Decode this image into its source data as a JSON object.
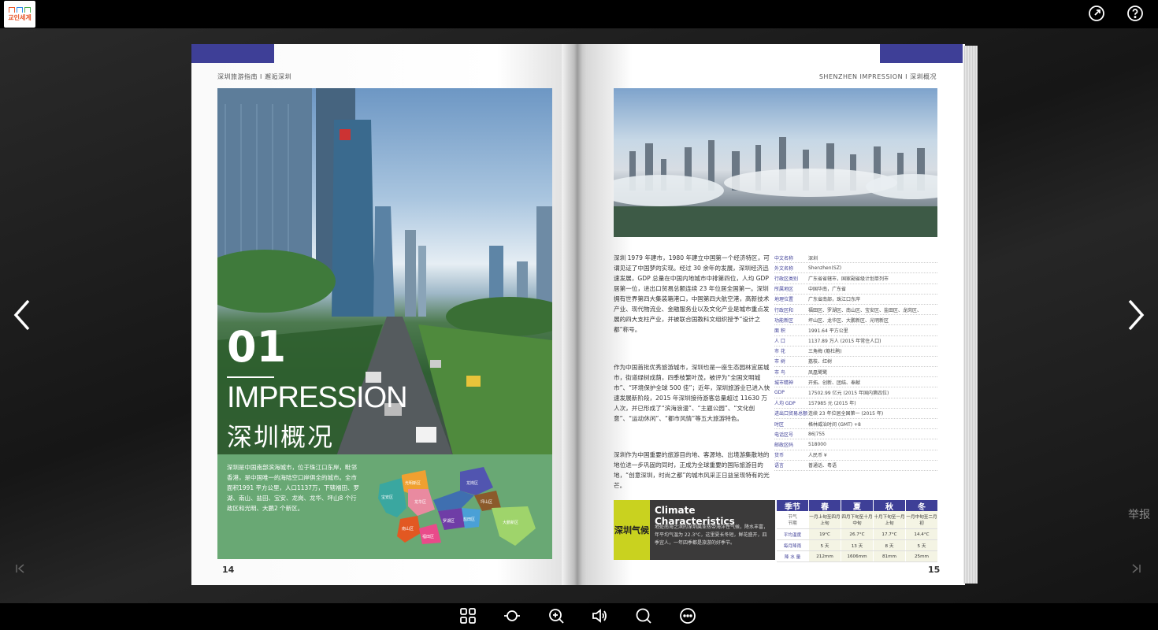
{
  "app": {
    "logo_text": "교인세계",
    "share_icon": "share-icon",
    "help_icon": "help-icon",
    "report_label": "举报"
  },
  "left_page": {
    "running_head": "深圳旅游指南 Ι 邂逅深圳",
    "number": "01",
    "title_en": "IMPRESSION",
    "title_cn": "深圳概况",
    "intro": "深圳是中国南部滨海城市，位于珠江口东岸，毗邻香港，是中国唯一的海陆空口岸俱全的城市。全市面积1991 平方公里，人口1137万，下辖福田、罗湖、南山、盐田、宝安、龙岗、龙华、坪山8 个行政区和光明、大鹏2 个新区。",
    "districts": [
      "光明新区",
      "宝安区",
      "龙华区",
      "龙岗区",
      "坪山区",
      "南山区",
      "福田区",
      "罗湖区",
      "盐田区",
      "大鹏新区"
    ],
    "page_number": "14"
  },
  "right_page": {
    "running_head": "SHENZHEN IMPRESSION  Ι  深圳概况",
    "para1": "深圳 1979 年建市，1980 年建立中国第一个经济特区，可谓见证了中国梦的实现。经过 30 余年的发展，深圳经济迅速发展，GDP 总量在中国内地城市中排第四位，人均 GDP 居第一位，进出口贸易总额连续 23 年位居全国第一。深圳拥有世界第四大集装箱港口，中国第四大航空港，高新技术产业、现代物流业、金融服务业以及文化产业是城市重点发展的四大支柱产业，并被联合国教科文组织授予“设计之都”称号。",
    "para2": "作为中国首批优秀旅游城市，深圳也是一座生态园林宜居城市，街道绿树成荫，四季枝繁叶茂，被评为“全国文明城市”、“环境保护全球 500 佳”；近年，深圳旅游业已进入快速发展新阶段，2015 年深圳接待游客总量超过 11630 万人次，并已形成了“滨海浪漫”、“主题公园”、“文化创意”、“运动休闲”、“都市风情”等五大旅游特色。",
    "para3": "深圳作为中国重要的旅游目的地、客源地、出境游集散地的地位进一步巩固的同时，正成为全球重要的国际旅游目的地，“创意深圳，时尚之都”的城市风采正日益呈现特有的光芒。",
    "info": [
      {
        "k": "中文名称",
        "v": "深圳"
      },
      {
        "k": "外文名称",
        "v": "Shenzhen(SZ)"
      },
      {
        "k": "行政区类别",
        "v": "广东省省辖市，国家副省级计划单列市"
      },
      {
        "k": "所属地区",
        "v": "中国华南，广东省"
      },
      {
        "k": "地理位置",
        "v": "广东省南部，珠江口东岸"
      },
      {
        "k": "行政区和",
        "v": "福田区、罗湖区、南山区、宝安区、盐田区、龙岗区、"
      },
      {
        "k": "功能新区",
        "v": "坪山区、龙华区、大鹏新区、光明新区"
      },
      {
        "k": "面  积",
        "v": "1991.64 平方公里"
      },
      {
        "k": "人  口",
        "v": "1137.89 万人 (2015 年常住人口)"
      },
      {
        "k": "市  花",
        "v": "三角梅 (簕杜鹃)"
      },
      {
        "k": "市  树",
        "v": "荔枝、红树"
      },
      {
        "k": "市  鸟",
        "v": "凤凰鹭鹭"
      },
      {
        "k": "城市精神",
        "v": "开拓、创新、团结、奉献"
      },
      {
        "k": "GDP",
        "v": "17502.99 亿元 (2015 年国内第四位)"
      },
      {
        "k": "人均 GDP",
        "v": "157985 元 (2015 年)"
      },
      {
        "k": "进出口贸易总额",
        "v": "连续 23 年位居全国第一 (2015 年)"
      },
      {
        "k": "时区",
        "v": "格林威治时间 (GMT) +8"
      },
      {
        "k": "电话区号",
        "v": "86|755"
      },
      {
        "k": "邮政区码",
        "v": "518000"
      },
      {
        "k": "货币",
        "v": "人民币 ¥"
      },
      {
        "k": "语言",
        "v": "普通话、粤语"
      }
    ],
    "climate": {
      "tag": "深圳气候",
      "title": "Climate Characteristics",
      "desc": "地处南海之滨的深圳属亚热带海洋性气候，降水丰富，年平均气温为 22.3°C，这里夏长冬短，鲜花盛开，四季宜人，一年四季都是旅游的好季节。",
      "head": [
        "季节",
        "春",
        "夏",
        "秋",
        "冬"
      ],
      "row_node_label": "节气",
      "row_node_sub": "节期",
      "nodes": [
        "一月上旬至四月上旬",
        "四月下旬至十月中旬",
        "十月下旬至一月上旬",
        "一月中旬至二月初"
      ],
      "temp_label": "平均温度",
      "temps": [
        "19°C",
        "26.7°C",
        "17.7°C",
        "14.4°C"
      ],
      "rain_days_label": "每月降雨",
      "rain_days": [
        "5 天",
        "13 天",
        "8 天",
        "5 天"
      ],
      "rain_label": "降 水 量",
      "rain": [
        "212mm",
        "1606mm",
        "81mm",
        "25mm"
      ]
    },
    "page_number": "15"
  },
  "toolbar": {
    "icons": [
      "grid-icon",
      "autoflip-icon",
      "zoom-in-icon",
      "sound-icon",
      "search-icon",
      "more-icon"
    ]
  },
  "colors": {
    "brand_blue": "#3e3f97",
    "green_panel": "#69a874",
    "climate_yellow": "#c9d21f"
  }
}
